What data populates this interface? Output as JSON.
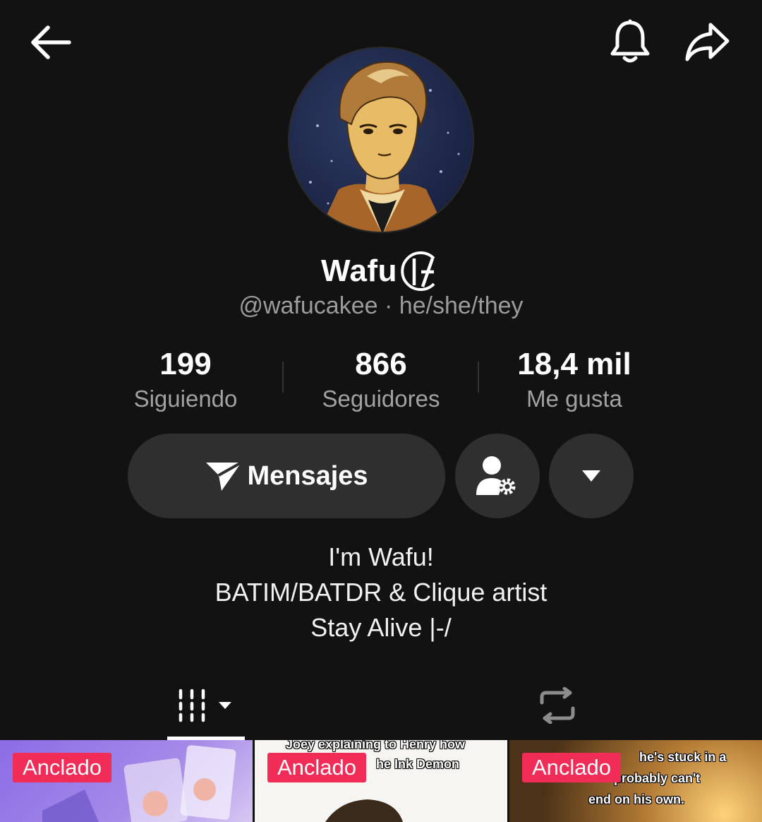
{
  "header": {
    "back_icon": "arrow-left-icon",
    "bell_icon": "bell-icon",
    "share_icon": "share-arrow-icon"
  },
  "profile": {
    "display_name": "Wafu",
    "name_badge": "twenty-one-pilots-logo",
    "handle_line": "@wafucakee · he/she/they"
  },
  "stats": [
    {
      "value": "199",
      "label": "Siguiendo"
    },
    {
      "value": "866",
      "label": "Seguidores"
    },
    {
      "value": "18,4 mil",
      "label": "Me gusta"
    }
  ],
  "actions": {
    "message_label": "Mensajes",
    "message_icon": "send-icon",
    "friend_settings_icon": "user-gear-icon",
    "more_icon": "caret-down-icon"
  },
  "bio": {
    "line1": "I'm Wafu!",
    "line2": "BATIM/BATDR & Clique artist",
    "line3": "Stay Alive |-/"
  },
  "tabs": [
    {
      "name": "videos",
      "icon": "grid-bars-icon",
      "active": true
    },
    {
      "name": "reposts",
      "icon": "repost-icon",
      "active": false
    }
  ],
  "videos": [
    {
      "badge": "Anclado",
      "caption": ""
    },
    {
      "badge": "Anclado",
      "caption_line1": "Joey explaining to Henry how",
      "caption_line2": "he Ink Demon"
    },
    {
      "badge": "Anclado",
      "caption_line1": "he's stuck in a",
      "caption_line2": "probably can't",
      "caption_line3": "end on his own."
    }
  ],
  "colors": {
    "background": "#121212",
    "button": "#2f2f2f",
    "pin_badge": "#f02c57",
    "muted_text": "#a2a2a2"
  }
}
